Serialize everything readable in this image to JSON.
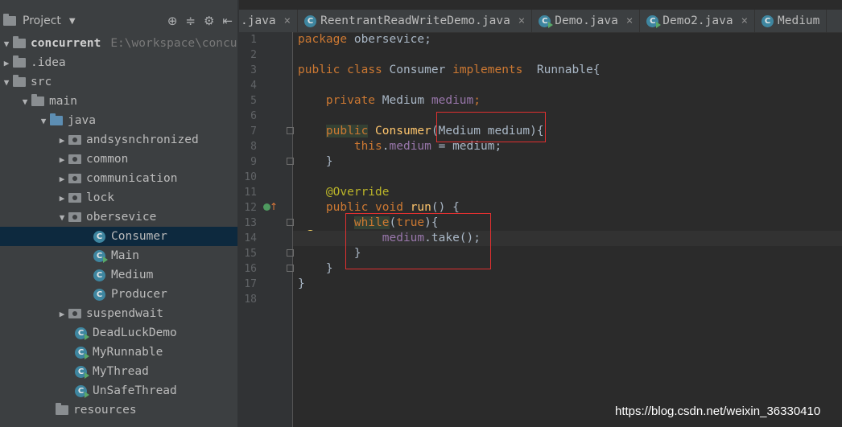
{
  "project_panel": {
    "title": "Project",
    "tree": [
      {
        "label": "concurrent",
        "path": "E:\\workspace\\concu"
      },
      {
        "label": ".idea"
      },
      {
        "label": "src"
      },
      {
        "label": "main"
      },
      {
        "label": "java"
      },
      {
        "label": "andsysnchronized"
      },
      {
        "label": "common"
      },
      {
        "label": "communication"
      },
      {
        "label": "lock"
      },
      {
        "label": "obersevice"
      },
      {
        "label": "Consumer"
      },
      {
        "label": "Main"
      },
      {
        "label": "Medium"
      },
      {
        "label": "Producer"
      },
      {
        "label": "suspendwait"
      },
      {
        "label": "DeadLuckDemo"
      },
      {
        "label": "MyRunnable"
      },
      {
        "label": "MyThread"
      },
      {
        "label": "UnSafeThread"
      },
      {
        "label": "resources"
      }
    ]
  },
  "tabs": [
    {
      "label": ".java"
    },
    {
      "label": "ReentrantReadWriteDemo.java"
    },
    {
      "label": "Demo.java"
    },
    {
      "label": "Demo2.java"
    },
    {
      "label": "Medium"
    }
  ],
  "editor": {
    "line_numbers": [
      "1",
      "2",
      "3",
      "4",
      "5",
      "6",
      "7",
      "8",
      "9",
      "10",
      "11",
      "12",
      "13",
      "14",
      "15",
      "16",
      "17",
      "18"
    ],
    "code": {
      "l1_kw": "package",
      "l1_rest": " obersevice;",
      "l3_kw1": "public",
      "l3_kw2": "class",
      "l3_name": " Consumer ",
      "l3_kw3": "implements",
      "l3_rest": "  Runnable{",
      "l5_kw": "private",
      "l5_type": " Medium ",
      "l5_field": "medium",
      "l5_semi": ";",
      "l7_kw": "public",
      "l7_fn": "Consumer",
      "l7_params": "(Medium medium)",
      "l7_brace": "{",
      "l8_kw": "this",
      "l8_dot": ".",
      "l8_field": "medium",
      "l8_rest": " = medium;",
      "l9": "}",
      "l11_ann": "@Override",
      "l12_kw1": "public",
      "l12_kw2": "void",
      "l12_fn": "run",
      "l12_rest": "() {",
      "l13_kw": "while",
      "l13_p1": "(",
      "l13_true": "true",
      "l13_p2": "){",
      "l14_field": "medium",
      "l14_rest": ".take();",
      "l15": "}",
      "l16": "}",
      "l17": "}"
    }
  },
  "watermark": "https://blog.csdn.net/weixin_36330410"
}
